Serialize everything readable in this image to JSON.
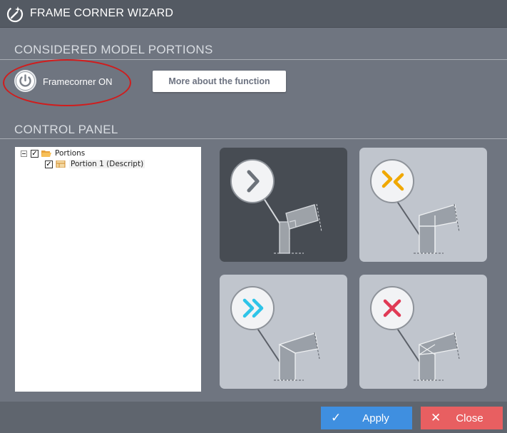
{
  "window": {
    "title": "FRAME CORNER WIZARD"
  },
  "sections": {
    "model_portions": "CONSIDERED MODEL PORTIONS",
    "control_panel": "CONTROL PANEL"
  },
  "framecorner": {
    "label": "Framecorner ON",
    "state": "on"
  },
  "more_button": {
    "label": "More about the function"
  },
  "tree": {
    "root": {
      "label": "Portions",
      "checked": true,
      "expanded": true
    },
    "children": [
      {
        "label": "Portion 1 (Descript)",
        "checked": true
      }
    ]
  },
  "options": [
    {
      "name": "single-chevron",
      "icon": "chevron-right-icon",
      "color": "#6c727a",
      "selected": true
    },
    {
      "name": "converging-chevrons",
      "icon": "converge-icon",
      "color": "#f0a800",
      "selected": false
    },
    {
      "name": "double-chevron",
      "icon": "double-chevron-right-icon",
      "color": "#2ec4e8",
      "selected": false
    },
    {
      "name": "no-corner",
      "icon": "x-icon",
      "color": "#e03a55",
      "selected": false
    }
  ],
  "footer": {
    "apply_label": "Apply",
    "close_label": "Close"
  },
  "colors": {
    "apply": "#3f8fe0",
    "close": "#e85f61",
    "highlight_ellipse": "#d11c1c"
  }
}
